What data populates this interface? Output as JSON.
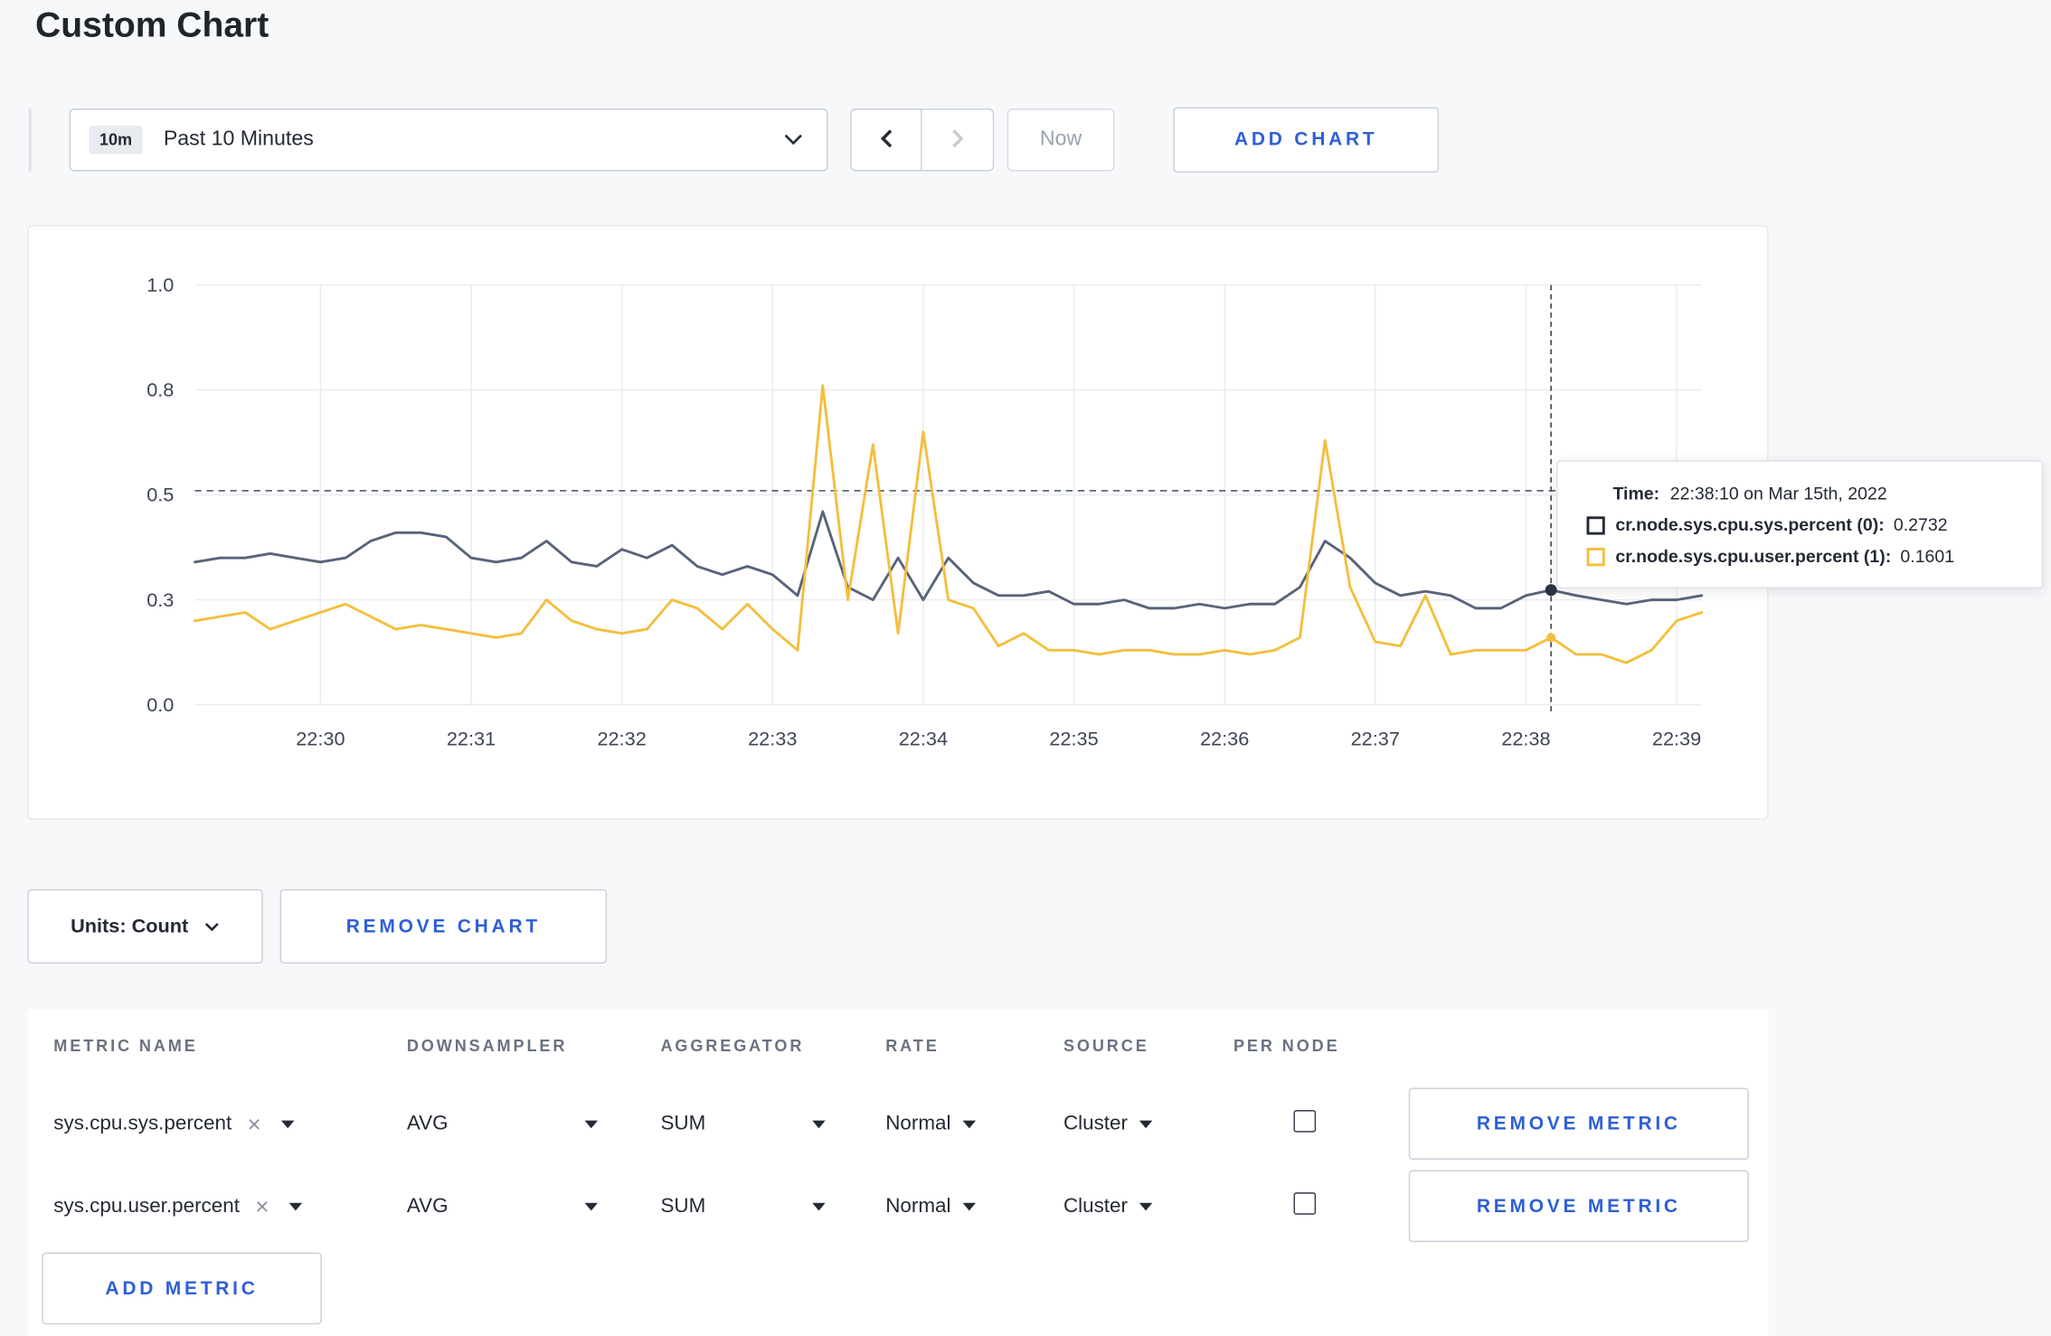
{
  "page": {
    "title": "Custom Chart"
  },
  "toolbar": {
    "time_badge": "10m",
    "time_label": "Past 10 Minutes",
    "now_label": "Now",
    "add_chart_label": "ADD CHART"
  },
  "chart_controls": {
    "units_label": "Units: Count",
    "remove_chart_label": "REMOVE CHART"
  },
  "tooltip": {
    "time_label": "Time:",
    "time_value": "22:38:10 on Mar 15th, 2022",
    "rows": [
      {
        "name": "cr.node.sys.cpu.sys.percent (0):",
        "value": "0.2732",
        "color": "#242a35"
      },
      {
        "name": "cr.node.sys.cpu.user.percent (1):",
        "value": "0.1601",
        "color": "#f3bf3f"
      }
    ]
  },
  "metrics_table": {
    "headers": [
      "METRIC NAME",
      "DOWNSAMPLER",
      "AGGREGATOR",
      "RATE",
      "SOURCE",
      "PER NODE"
    ],
    "rows": [
      {
        "metric": "sys.cpu.sys.percent",
        "downsampler": "AVG",
        "aggregator": "SUM",
        "rate": "Normal",
        "source": "Cluster",
        "per_node": false,
        "remove_label": "REMOVE METRIC"
      },
      {
        "metric": "sys.cpu.user.percent",
        "downsampler": "AVG",
        "aggregator": "SUM",
        "rate": "Normal",
        "source": "Cluster",
        "per_node": false,
        "remove_label": "REMOVE METRIC"
      }
    ],
    "add_metric_label": "ADD METRIC"
  },
  "icons": {
    "clear": "×"
  },
  "chart_data": {
    "type": "line",
    "title": "",
    "xlabel": "",
    "ylabel": "",
    "ylim": [
      0,
      1
    ],
    "grid": true,
    "x_start": "22:29:10",
    "x_end": "22:39:10",
    "x_interval_seconds": 10,
    "x_first_tick_offset_seconds": 50,
    "x_tick_interval_seconds": 60,
    "x_tick_labels": [
      "22:30",
      "22:31",
      "22:32",
      "22:33",
      "22:34",
      "22:35",
      "22:36",
      "22:37",
      "22:38",
      "22:39"
    ],
    "y_tick_labels": [
      "0.0",
      "0.3",
      "0.5",
      "0.8",
      "1.0"
    ],
    "threshold_value": 0.51,
    "crosshair": {
      "time": "22:38:10",
      "index": 54
    },
    "series": [
      {
        "name": "cr.node.sys.cpu.sys.percent",
        "color": "#59637a",
        "dot_color": "#2b3240",
        "values": [
          0.34,
          0.35,
          0.35,
          0.36,
          0.35,
          0.34,
          0.35,
          0.39,
          0.41,
          0.41,
          0.4,
          0.35,
          0.34,
          0.35,
          0.39,
          0.34,
          0.33,
          0.37,
          0.35,
          0.38,
          0.33,
          0.31,
          0.33,
          0.31,
          0.26,
          0.46,
          0.28,
          0.25,
          0.35,
          0.25,
          0.35,
          0.29,
          0.26,
          0.26,
          0.27,
          0.24,
          0.24,
          0.25,
          0.23,
          0.23,
          0.24,
          0.23,
          0.24,
          0.24,
          0.28,
          0.39,
          0.35,
          0.29,
          0.26,
          0.27,
          0.26,
          0.23,
          0.23,
          0.26,
          0.2732,
          0.26,
          0.25,
          0.24,
          0.25,
          0.25,
          0.26
        ]
      },
      {
        "name": "cr.node.sys.cpu.user.percent",
        "color": "#f3bf3f",
        "dot_color": "#f3bf3f",
        "values": [
          0.2,
          0.21,
          0.22,
          0.18,
          0.2,
          0.22,
          0.24,
          0.21,
          0.18,
          0.19,
          0.18,
          0.17,
          0.16,
          0.17,
          0.25,
          0.2,
          0.18,
          0.17,
          0.18,
          0.25,
          0.23,
          0.18,
          0.24,
          0.18,
          0.13,
          0.76,
          0.25,
          0.62,
          0.17,
          0.65,
          0.25,
          0.23,
          0.14,
          0.17,
          0.13,
          0.13,
          0.12,
          0.13,
          0.13,
          0.12,
          0.12,
          0.13,
          0.12,
          0.13,
          0.16,
          0.63,
          0.28,
          0.15,
          0.14,
          0.26,
          0.12,
          0.13,
          0.13,
          0.13,
          0.1601,
          0.12,
          0.12,
          0.1,
          0.13,
          0.2,
          0.22
        ]
      }
    ],
    "legend_position": "tooltip"
  }
}
